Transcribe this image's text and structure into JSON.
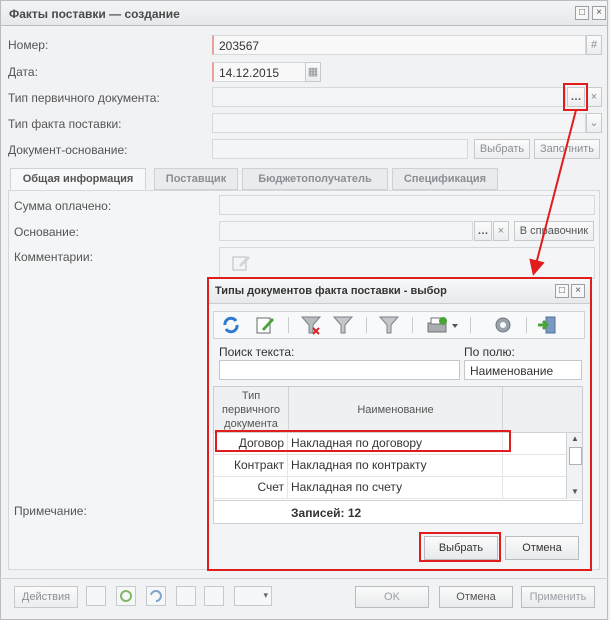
{
  "window": {
    "title": "Факты поставки — создание"
  },
  "form": {
    "number_label": "Номер:",
    "number_value": "203567",
    "date_label": "Дата:",
    "date_value": "14.12.2015",
    "doc_type_label": "Тип первичного документа:",
    "fact_type_label": "Тип факта поставки:",
    "base_doc_label": "Документ-основание:",
    "select_button": "Выбрать",
    "fill_button": "Заполнить"
  },
  "tabs": [
    "Общая информация",
    "Поставщик",
    "Бюджетополучатель",
    "Спецификация"
  ],
  "general": {
    "paid_label": "Сумма оплачено:",
    "basis_label": "Основание:",
    "in_reference_button": "В справочник",
    "comments_label": "Комментарии:",
    "note_label": "Примечание:"
  },
  "dialog": {
    "title": "Типы документов факта поставки - выбор",
    "search_label": "Поиск текста:",
    "field_label": "По полю:",
    "field_value": "Наименование",
    "col_type": "Тип первичного документа",
    "col_name": "Наименование",
    "rows": [
      {
        "type": "Договор",
        "name": "Накладная по договору"
      },
      {
        "type": "Контракт",
        "name": "Накладная по контракту"
      },
      {
        "type": "Счет",
        "name": "Накладная по счету"
      }
    ],
    "records": "Записей: 12",
    "select_button": "Выбрать",
    "cancel_button": "Отмена"
  },
  "footer": {
    "actions": "Действия",
    "ok": "OK",
    "cancel": "Отмена",
    "apply": "Применить"
  }
}
